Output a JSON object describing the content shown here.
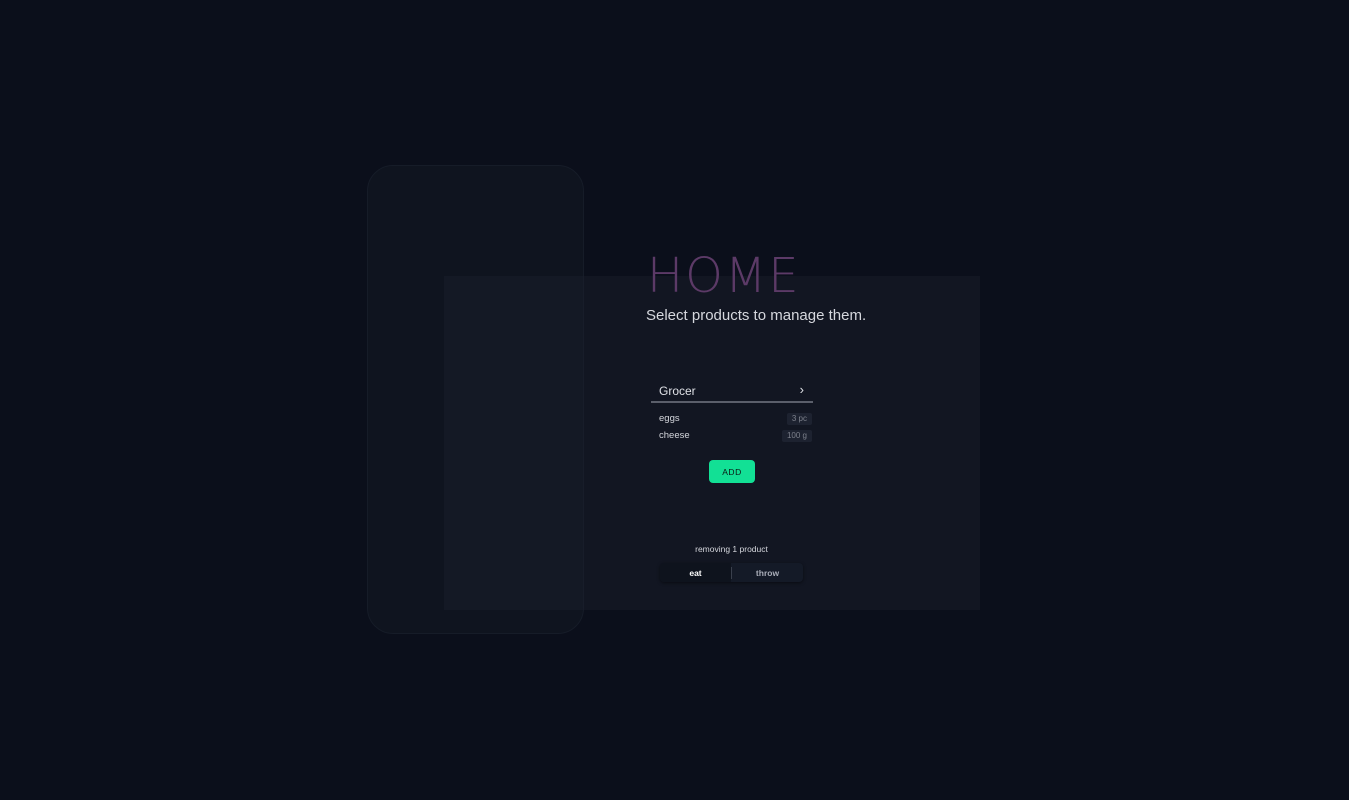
{
  "header": {
    "title": "HOME",
    "subtitle": "Select products to manage them."
  },
  "store": {
    "name": "Grocer",
    "chevron": "›",
    "products": [
      {
        "name": "eggs",
        "quantity": "3 pc"
      },
      {
        "name": "cheese",
        "quantity": "100 g"
      }
    ]
  },
  "actions": {
    "add_label": "ADD",
    "removing_text": "removing 1 product",
    "eat_label": "eat",
    "throw_label": "throw"
  },
  "colors": {
    "background": "#0b0f1b",
    "title": "#5c3a67",
    "accent": "#12e095"
  }
}
